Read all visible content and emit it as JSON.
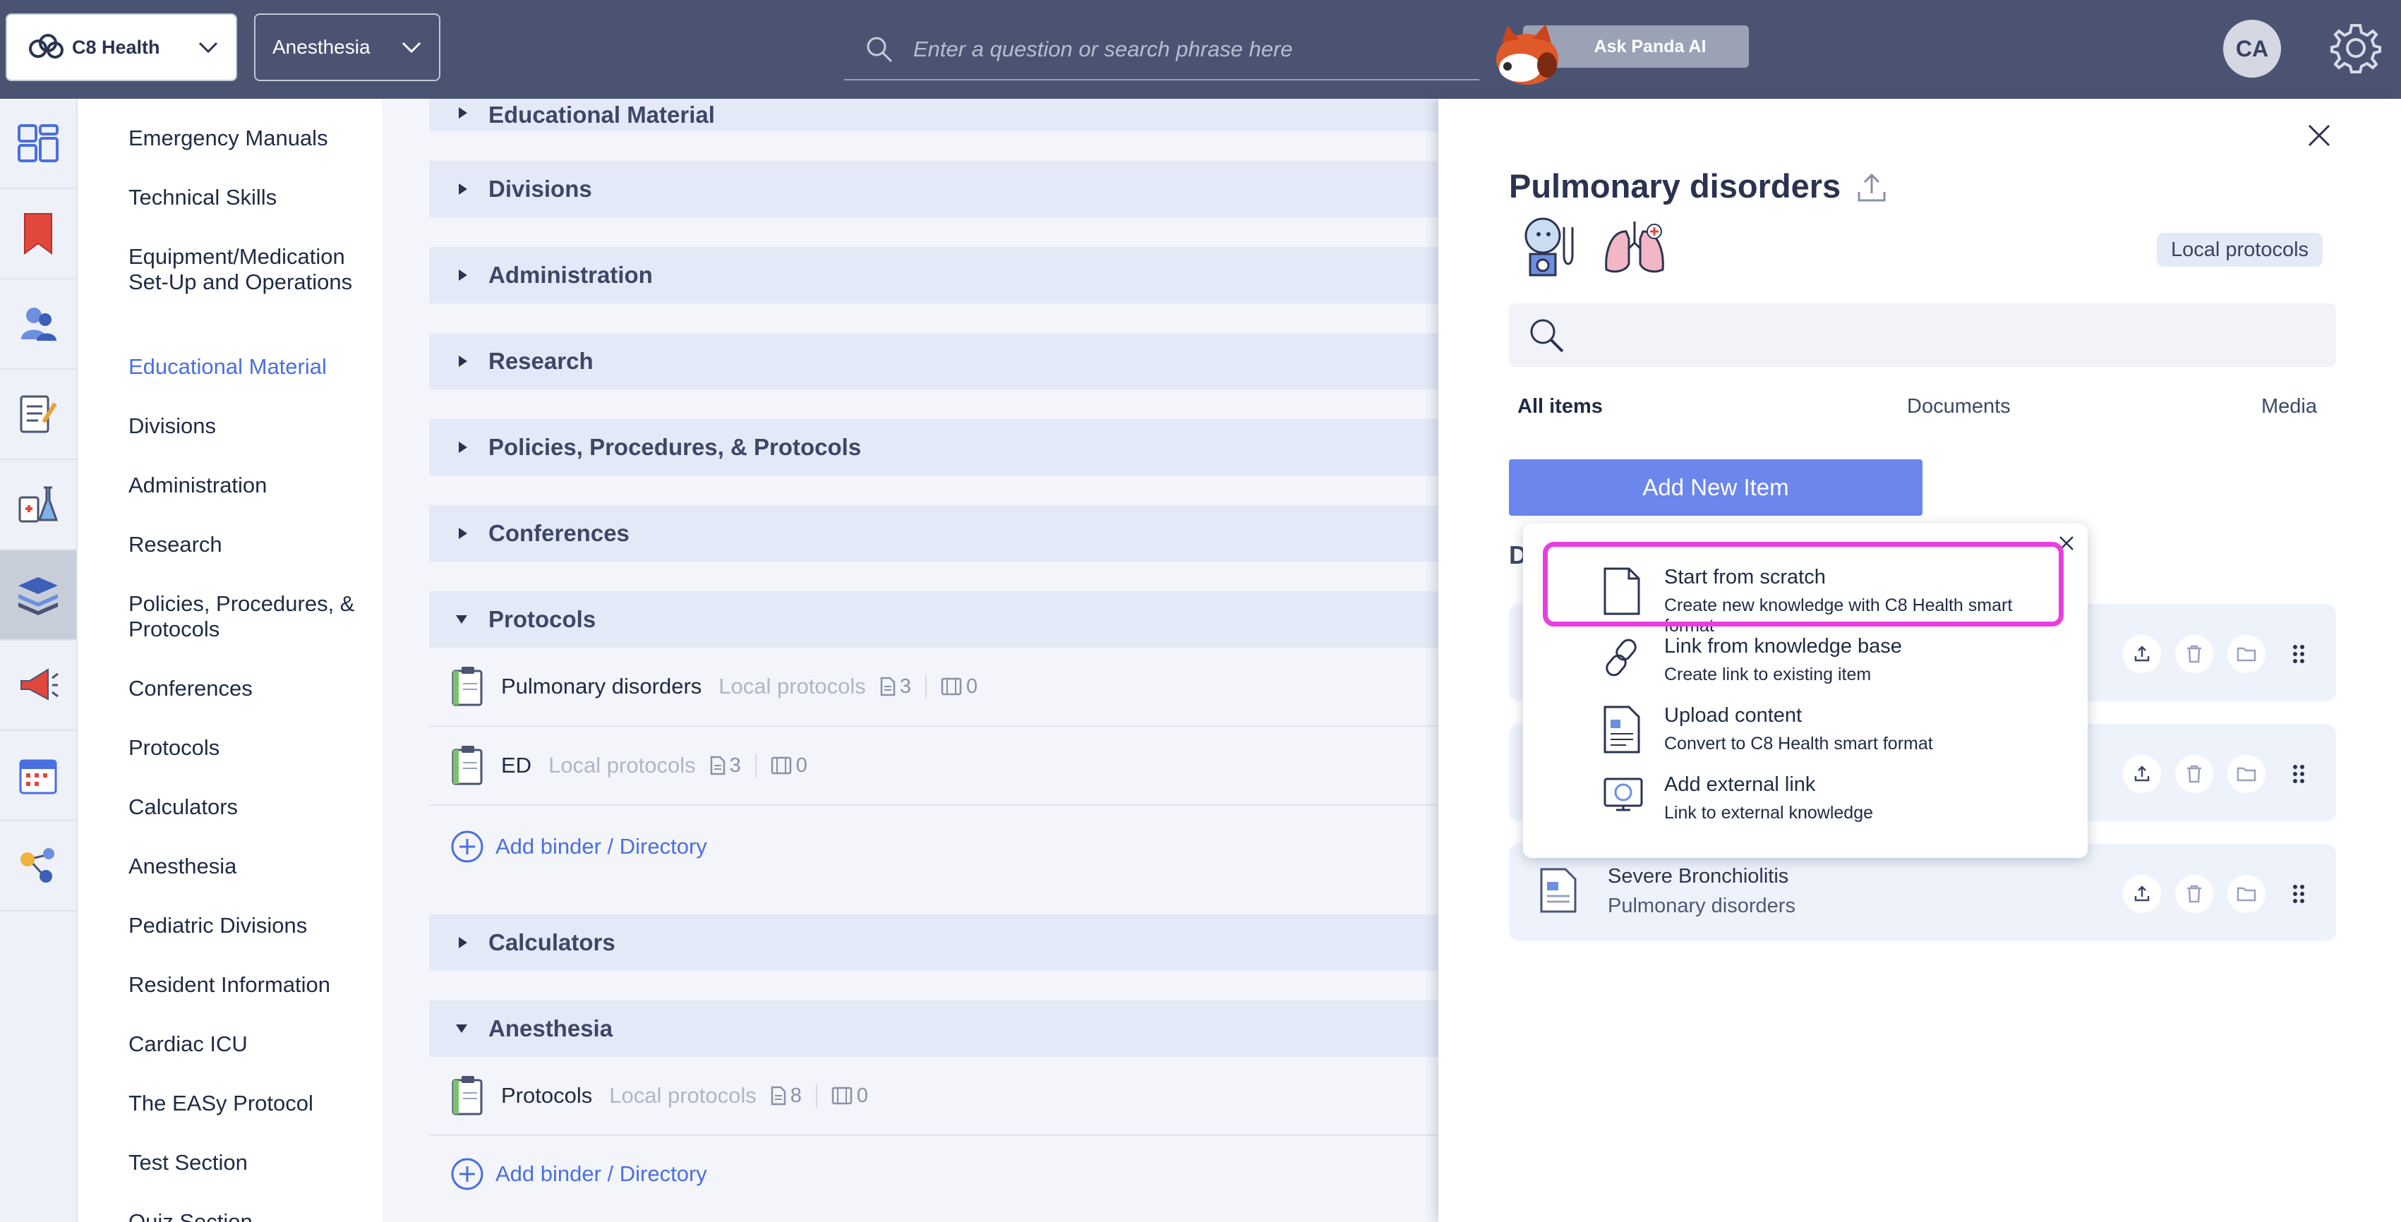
{
  "topbar": {
    "org": "C8 Health",
    "department": "Anesthesia",
    "search_placeholder": "Enter a question or search phrase here",
    "ask_ai": "Ask Panda AI",
    "avatar_initials": "CA"
  },
  "nav": {
    "items": [
      "Emergency Manuals",
      "Technical Skills",
      "Equipment/Medication Set-Up and Operations",
      "Educational Material",
      "Divisions",
      "Administration",
      "Research",
      "Policies, Procedures, & Protocols",
      "Conferences",
      "Protocols",
      "Calculators",
      "Anesthesia",
      "Pediatric Divisions",
      "Resident Information",
      "Cardiac ICU",
      "The EASy Protocol",
      "Test Section",
      "Quiz Section"
    ],
    "active": "Educational Material"
  },
  "main": {
    "sections": [
      {
        "label": "Educational Material",
        "expanded": false
      },
      {
        "label": "Divisions",
        "expanded": false
      },
      {
        "label": "Administration",
        "expanded": false
      },
      {
        "label": "Research",
        "expanded": false
      },
      {
        "label": "Policies, Procedures, & Protocols",
        "expanded": false
      },
      {
        "label": "Conferences",
        "expanded": false
      },
      {
        "label": "Protocols",
        "expanded": true
      },
      {
        "label": "Calculators",
        "expanded": false
      },
      {
        "label": "Anesthesia",
        "expanded": true
      }
    ],
    "protocols_binders": [
      {
        "title": "Pulmonary disorders",
        "tag": "Local protocols",
        "docs": "3",
        "media": "0"
      },
      {
        "title": "ED",
        "tag": "Local protocols",
        "docs": "3",
        "media": "0"
      }
    ],
    "anesthesia_binders": [
      {
        "title": "Protocols",
        "tag": "Local protocols",
        "docs": "8",
        "media": "0"
      }
    ],
    "add_binder_label": "Add binder / Directory"
  },
  "panel": {
    "title": "Pulmonary disorders",
    "badge": "Local protocols",
    "tabs": [
      "All items",
      "Documents",
      "Media"
    ],
    "active_tab": "All items",
    "add_new_item": "Add New Item",
    "section_heading_partial": "D",
    "documents": [
      {
        "title": "",
        "subtitle": ""
      },
      {
        "title": "",
        "subtitle": ""
      },
      {
        "title": "Severe Bronchiolitis",
        "subtitle": "Pulmonary disorders"
      }
    ]
  },
  "popup": {
    "items": [
      {
        "title": "Start from scratch",
        "subtitle": "Create new knowledge with C8 Health smart format",
        "highlighted": true
      },
      {
        "title": "Link from knowledge base",
        "subtitle": "Create link to existing item"
      },
      {
        "title": "Upload content",
        "subtitle": "Convert to C8 Health smart format"
      },
      {
        "title": "Add external link",
        "subtitle": "Link to external knowledge"
      }
    ]
  },
  "colors": {
    "topbar": "#4a5472",
    "accent": "#4a6fe0",
    "button": "#6b86ec",
    "highlight": "#e83ee0"
  }
}
